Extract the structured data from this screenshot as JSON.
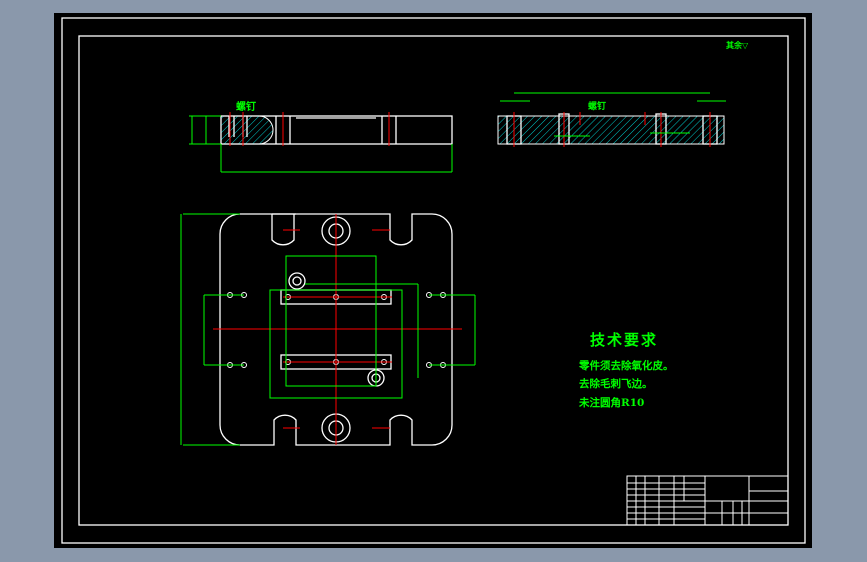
{
  "drawing": {
    "background_color": "#8a98ab",
    "sheet_color": "#000000",
    "outline_color": "#ffffff",
    "dimension_color": "#00ff00",
    "centerline_color": "#ff0000",
    "section_hatch_color": "#00ffff"
  },
  "annotations": {
    "roughness_note": "其余▽",
    "section_label_left": "螺钉",
    "section_label_right": "螺钉"
  },
  "technical_requirements": {
    "title": "技术要求",
    "items": [
      "零件须去除氧化皮。",
      "去除毛刺飞边。",
      "未注圆角R10"
    ]
  }
}
